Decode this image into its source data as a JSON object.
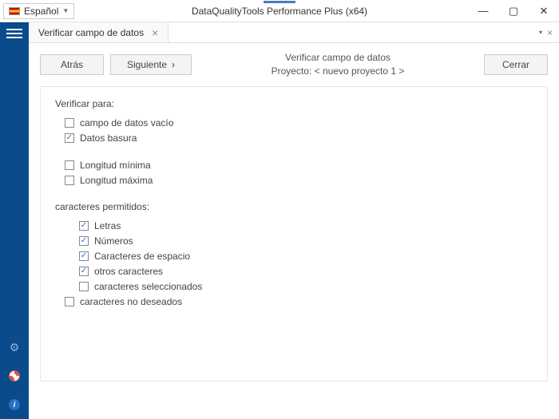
{
  "titlebar": {
    "language": "Español",
    "title": "DataQualityTools Performance Plus (x64)"
  },
  "tab": {
    "label": "Verificar campo de datos"
  },
  "toolbar": {
    "back": "Atrás",
    "next": "Siguiente",
    "close": "Cerrar",
    "header_line1": "Verificar campo de datos",
    "header_line2": "Proyecto: < nuevo proyecto 1 >"
  },
  "panel": {
    "verify_label": "Verificar para:",
    "empty_field": "campo de datos vacío",
    "garbage": "Datos basura",
    "min_length": "Longitud mínima",
    "max_length": "Longitud máxima",
    "allowed_label": "caracteres permitidos:",
    "letters": "Letras",
    "numbers": "Números",
    "spaces": "Caracteres de espacio",
    "other": "otros caracteres",
    "selected": "caracteres seleccionados",
    "unwanted": "caracteres no deseados"
  },
  "checks": {
    "empty_field": false,
    "garbage": true,
    "min_length": false,
    "max_length": false,
    "letters": true,
    "numbers": true,
    "spaces": true,
    "other": true,
    "selected": false,
    "unwanted": false
  }
}
